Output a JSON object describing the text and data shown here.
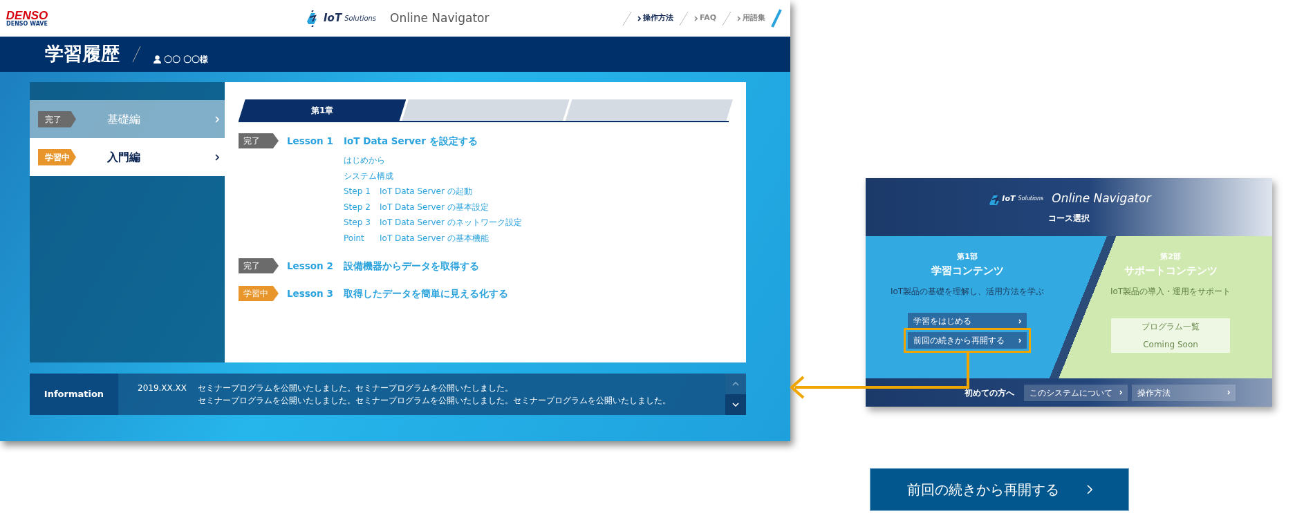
{
  "header": {
    "logo_top": "DENSO",
    "logo_bottom": "DENSO WAVE",
    "brand": "IoT",
    "brand_sub": "Solutions",
    "title": "Online Navigator",
    "links": [
      {
        "label": "操作方法",
        "selected": true
      },
      {
        "label": "FAQ",
        "selected": false
      },
      {
        "label": "用語集",
        "selected": false
      }
    ]
  },
  "title_bar": {
    "title": "学習履歴",
    "user": "〇〇 〇〇様"
  },
  "courses": [
    {
      "status": "完了",
      "kind": "done",
      "label": "基礎編",
      "selected": false
    },
    {
      "status": "学習中",
      "kind": "learning",
      "label": "入門編",
      "selected": true
    }
  ],
  "chapter_tabs": [
    {
      "label": "第1章",
      "selected": true
    },
    {
      "selected": false
    },
    {
      "selected": false
    }
  ],
  "lessons": [
    {
      "status": "完了",
      "kind": "done",
      "number": "Lesson 1",
      "title": "IoT Data Server を設定する",
      "steps": [
        {
          "text": "はじめから"
        },
        {
          "text": "システム構成"
        },
        {
          "prefix": "Step 1",
          "text": "IoT Data Server の起動"
        },
        {
          "prefix": "Step 2",
          "text": "IoT Data Server の基本設定"
        },
        {
          "prefix": "Step 3",
          "text": "IoT Data Server のネットワーク設定"
        },
        {
          "prefix": "Point",
          "text": "IoT Data Server の基本機能"
        }
      ]
    },
    {
      "status": "完了",
      "kind": "done",
      "number": "Lesson 2",
      "title": "設備機器からデータを取得する"
    },
    {
      "status": "学習中",
      "kind": "learning",
      "number": "Lesson 3",
      "title": "取得したデータを簡単に見える化する"
    }
  ],
  "information": {
    "heading": "Information",
    "date": "2019.XX.XX",
    "lines": [
      "セミナープログラムを公開いたしました。セミナープログラムを公開いたしました。",
      "セミナープログラムを公開いたしました。セミナープログラムを公開いたしました。セミナープログラムを公開いたしました。"
    ]
  },
  "thumbnail": {
    "brand": "IoT",
    "brand_sub": "Solutions",
    "title": "Online Navigator",
    "subtitle": "コース選択",
    "parts": [
      {
        "part": "第1部",
        "title": "学習コンテンツ",
        "description": "IoT製品の基礎を理解し、活用方法を学ぶ",
        "disabled": false,
        "buttons": [
          {
            "label": "学習をはじめる",
            "highlighted": false
          },
          {
            "label": "前回の続きから再開する",
            "highlighted": true
          }
        ]
      },
      {
        "part": "第2部",
        "title": "サポートコンテンツ",
        "description": "IoT製品の導入・運用をサポート",
        "disabled": true,
        "buttons": [
          {
            "label": "プログラム一覧",
            "sub": "Coming Soon",
            "highlighted": false
          }
        ]
      }
    ],
    "footer": {
      "label": "初めての方へ",
      "buttons": [
        "このシステムについて",
        "操作方法"
      ]
    }
  },
  "callout_button": {
    "label": "前回の続きから再開する"
  }
}
